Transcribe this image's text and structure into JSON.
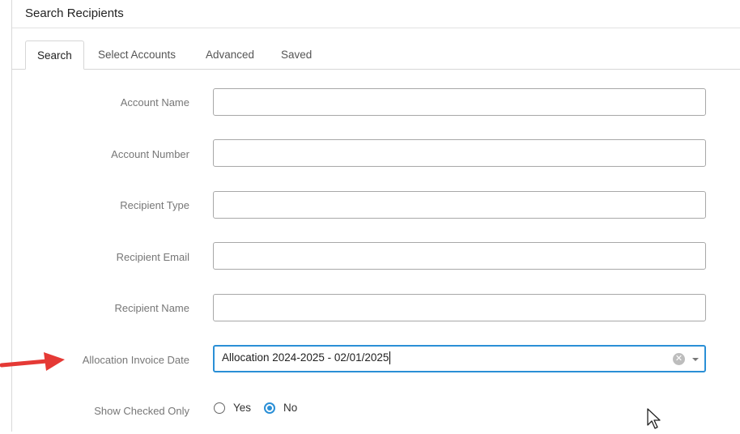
{
  "dialog": {
    "title": "Search Recipients"
  },
  "tabs": [
    {
      "label": "Search",
      "active": true
    },
    {
      "label": "Select Accounts",
      "active": false
    },
    {
      "label": "Advanced",
      "active": false
    },
    {
      "label": "Saved",
      "active": false
    }
  ],
  "fields": {
    "account_name": {
      "label": "Account Name",
      "value": ""
    },
    "account_number": {
      "label": "Account Number",
      "value": ""
    },
    "recipient_type": {
      "label": "Recipient Type",
      "value": ""
    },
    "recipient_email": {
      "label": "Recipient Email",
      "value": ""
    },
    "recipient_name": {
      "label": "Recipient Name",
      "value": ""
    },
    "allocation_invoice_date": {
      "label": "Allocation Invoice Date",
      "value": "Allocation 2024-2025 - 02/01/2025"
    }
  },
  "show_checked_only": {
    "label": "Show Checked Only",
    "options": [
      {
        "label": "Yes",
        "checked": false
      },
      {
        "label": "No",
        "checked": true
      }
    ]
  },
  "colors": {
    "accent": "#2a8fd6",
    "annotation_arrow": "#e53935"
  },
  "icons": {
    "clear": "clear-icon",
    "dropdown": "chevron-down-icon",
    "pointer": "mouse-pointer-icon",
    "annotation": "red-arrow-icon"
  }
}
